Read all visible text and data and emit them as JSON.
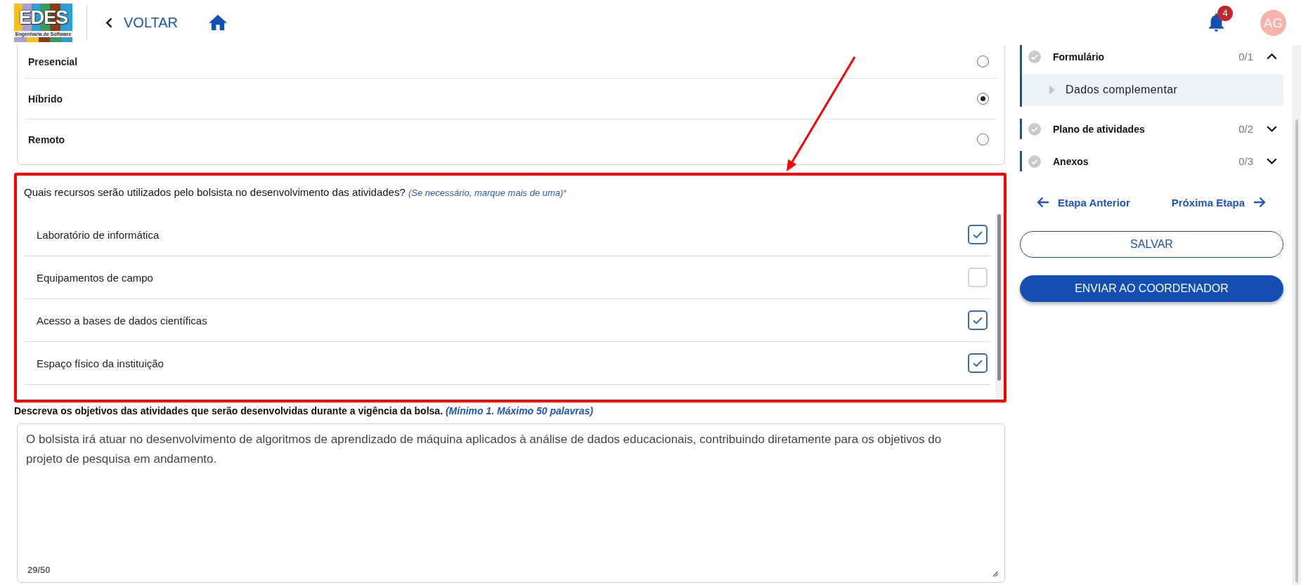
{
  "header": {
    "logo": {
      "wordmark": "EDES",
      "tagline": "Engenharia de Software"
    },
    "back_link": {
      "label": "VOLTAR"
    },
    "notifications": {
      "count": "4"
    },
    "avatar": {
      "initials": "AG"
    }
  },
  "modality_options": [
    {
      "label": "Presencial",
      "selected": false
    },
    {
      "label": "Híbrido",
      "selected": true
    },
    {
      "label": "Remoto",
      "selected": false
    }
  ],
  "resources_question": {
    "question": "Quais recursos serão utilizados pelo bolsista no desenvolvimento das atividades?",
    "hint": "(Se necessário, marque mais de uma)",
    "required_mark": "*",
    "options": [
      {
        "label": "Laboratório de informática",
        "checked": true
      },
      {
        "label": "Equipamentos de campo",
        "checked": false
      },
      {
        "label": "Acesso a bases de dados científicas",
        "checked": true
      },
      {
        "label": "Espaço físico da instituição",
        "checked": true
      }
    ]
  },
  "objectives": {
    "label": "Descreva os objetivos das atividades que serão desenvolvidas durante a vigência da bolsa.",
    "hint": "(Mínimo 1. Máximo 50 palavras)",
    "value": "O bolsista irá atuar no desenvolvimento de algoritmos de aprendizado de máquina aplicados à análise de dados educacionais, contribuindo diretamente para os objetivos do projeto de pesquisa em andamento.",
    "counter": "29/50"
  },
  "sidebar": {
    "sections": [
      {
        "title": "Formulário",
        "progress": "0/1",
        "completed": false,
        "expanded": true,
        "children": [
          {
            "label": "Dados complementar",
            "selected": true
          }
        ]
      },
      {
        "title": "Plano de atividades",
        "progress": "0/2",
        "completed": false,
        "expanded": false
      },
      {
        "title": "Anexos",
        "progress": "0/3",
        "completed": false,
        "expanded": false
      }
    ],
    "prev_step": {
      "label": "Etapa Anterior"
    },
    "next_step": {
      "label": "Próxima Etapa"
    },
    "buttons": [
      {
        "label": "SALVAR",
        "kind": "outline"
      },
      {
        "label": "ENVIAR AO COORDENADOR",
        "kind": "primary"
      }
    ]
  }
}
